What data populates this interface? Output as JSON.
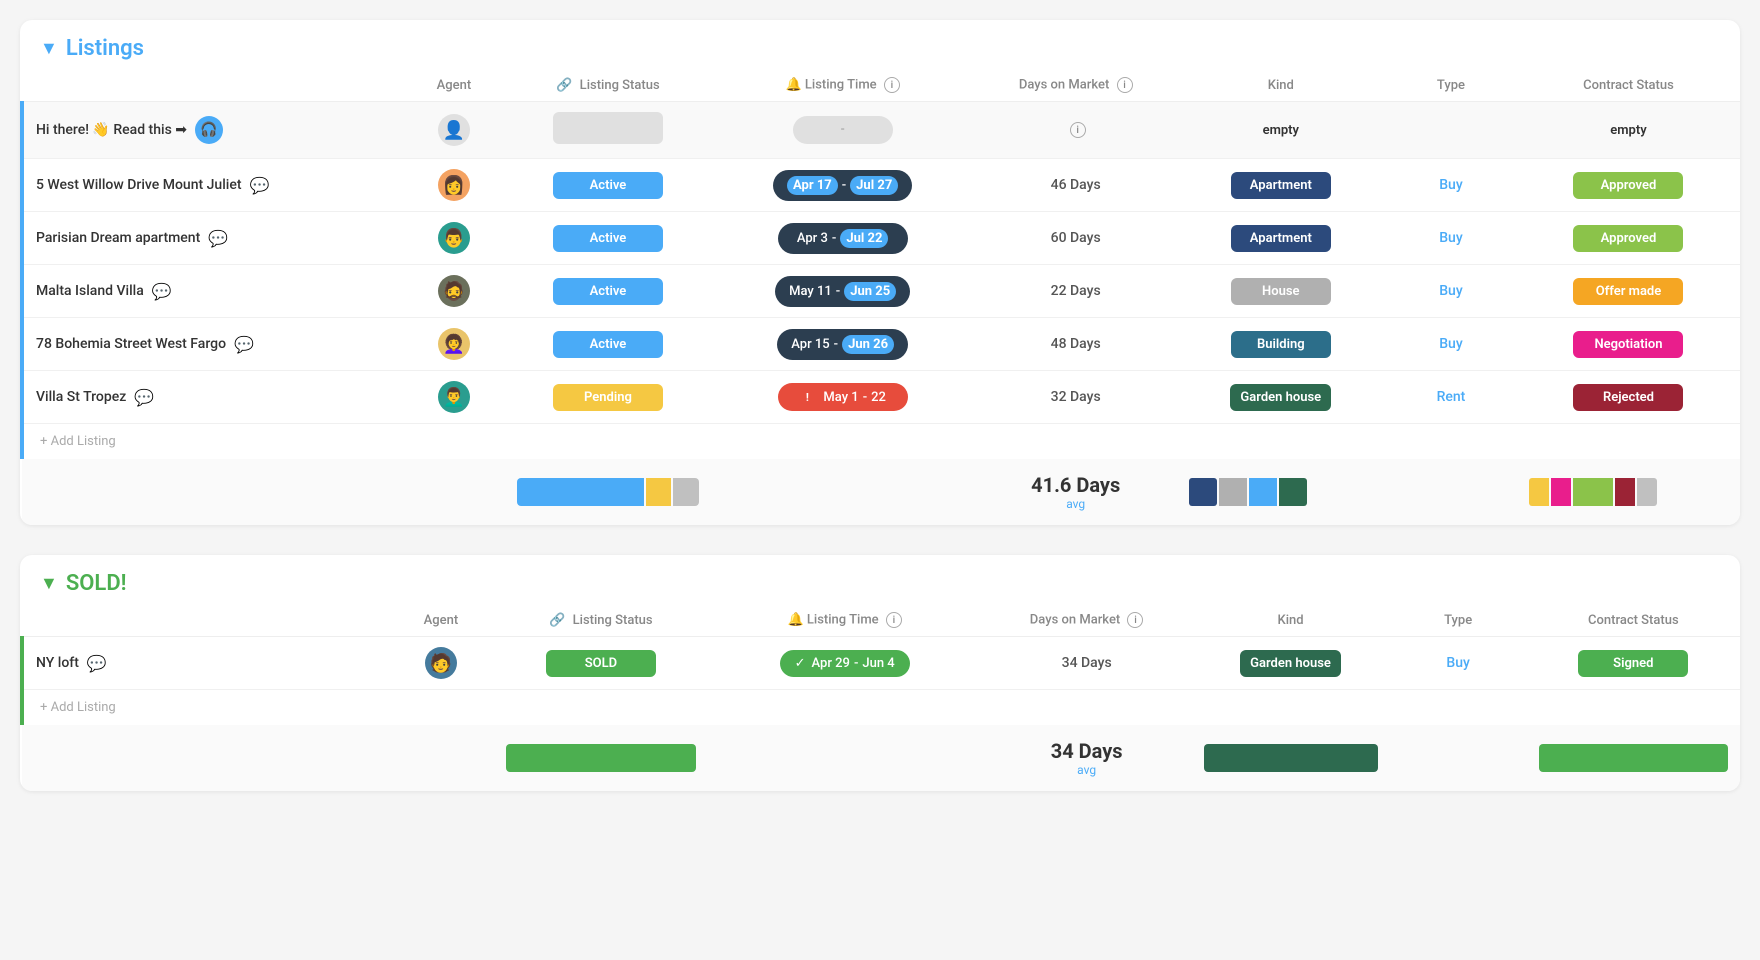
{
  "sections": [
    {
      "id": "listings",
      "title": "Listings",
      "color": "listings",
      "chevron": "▼",
      "columns": [
        "Agent",
        "Listing Status",
        "Listing Time",
        "Days on Market",
        "Kind",
        "Type",
        "Contract Status"
      ],
      "rows": [
        {
          "id": "hi-there",
          "name": "Hi there! 👋 Read this ➡",
          "hasChat": true,
          "agent": "placeholder",
          "listingStatus": "empty",
          "listingTime": "dash",
          "daysOnMarket": "info",
          "kind": "empty",
          "type": "",
          "contractStatus": "empty"
        },
        {
          "id": "west-willow",
          "name": "5 West Willow Drive Mount Juliet",
          "hasComment": true,
          "agent": "woman1",
          "listingStatus": "Active",
          "listingStatusClass": "status-active",
          "listingTime": "Apr 17 - Jul 27",
          "timeStart": "Apr 17",
          "timeEnd": "Jul 27",
          "timeClass": "time-dark",
          "highlightStart": true,
          "daysOnMarket": "46 Days",
          "kind": "Apartment",
          "kindClass": "kind-apartment",
          "type": "Buy",
          "contractStatus": "Approved",
          "contractClass": "contract-approved"
        },
        {
          "id": "parisian-dream",
          "name": "Parisian Dream apartment",
          "hasComment": true,
          "agent": "man1",
          "listingStatus": "Active",
          "listingStatusClass": "status-active",
          "listingTime": "Apr 3 - Jul 22",
          "timeStart": "Apr 3",
          "timeEnd": "Jul 22",
          "timeClass": "time-dark",
          "highlightEnd": true,
          "daysOnMarket": "60 Days",
          "kind": "Apartment",
          "kindClass": "kind-apartment",
          "type": "Buy",
          "contractStatus": "Approved",
          "contractClass": "contract-approved"
        },
        {
          "id": "malta-island",
          "name": "Malta Island Villa",
          "hasComment": true,
          "agent": "man2",
          "listingStatus": "Active",
          "listingStatusClass": "status-active",
          "listingTime": "May 11 - Jun 25",
          "timeStart": "May 11",
          "timeEnd": "Jun 25",
          "timeClass": "time-dark",
          "highlightEnd": true,
          "daysOnMarket": "22 Days",
          "kind": "House",
          "kindClass": "kind-house",
          "type": "Buy",
          "contractStatus": "Offer made",
          "contractClass": "contract-offer"
        },
        {
          "id": "bohemia-street",
          "name": "78 Bohemia Street West Fargo",
          "hasComment": true,
          "agent": "woman2",
          "listingStatus": "Active",
          "listingStatusClass": "status-active",
          "listingTime": "Apr 15 - Jun 26",
          "timeStart": "Apr 15",
          "timeEnd": "Jun 26",
          "timeClass": "time-dark",
          "highlightEnd": true,
          "daysOnMarket": "48 Days",
          "kind": "Building",
          "kindClass": "kind-building",
          "type": "Buy",
          "contractStatus": "Negotiation",
          "contractClass": "contract-negotiation"
        },
        {
          "id": "villa-st-tropez",
          "name": "Villa St Tropez",
          "hasComment": true,
          "agent": "man3",
          "listingStatus": "Pending",
          "listingStatusClass": "status-pending",
          "listingTime": "May 1 - 22",
          "timeStart": "May 1",
          "timeEnd": "22",
          "timeClass": "time-red",
          "hasAlert": true,
          "daysOnMarket": "32 Days",
          "kind": "Garden house",
          "kindClass": "kind-garden",
          "type": "Rent",
          "contractStatus": "Rejected",
          "contractClass": "contract-rejected"
        }
      ],
      "addListing": "+ Add Listing",
      "summary": {
        "avgDays": "41.6 Days",
        "avgLabel": "avg"
      }
    },
    {
      "id": "sold",
      "title": "SOLD!",
      "color": "sold",
      "chevron": "▼",
      "columns": [
        "Agent",
        "Listing Status",
        "Listing Time",
        "Days on Market",
        "Kind",
        "Type",
        "Contract Status"
      ],
      "rows": [
        {
          "id": "ny-loft",
          "name": "NY loft",
          "hasComment": true,
          "agent": "man4",
          "listingStatus": "SOLD",
          "listingStatusClass": "status-sold",
          "listingTime": "Apr 29 - Jun 4",
          "timeStart": "Apr 29",
          "timeEnd": "Jun 4",
          "timeClass": "time-green",
          "hasCheck": true,
          "daysOnMarket": "34 Days",
          "kind": "Garden house",
          "kindClass": "kind-garden",
          "type": "Buy",
          "contractStatus": "Signed",
          "contractClass": "contract-signed"
        }
      ],
      "addListing": "+ Add Listing",
      "summary": {
        "avgDays": "34 Days",
        "avgLabel": "avg"
      }
    }
  ],
  "icons": {
    "comment": "💬",
    "chat": "🎧",
    "info": "ℹ",
    "link": "🔗",
    "bell": "🔔",
    "alert": "!",
    "check": "✓",
    "chevron_down": "▼"
  },
  "avatars": {
    "woman1": "👩",
    "man1": "👨",
    "man2": "🧔",
    "woman2": "👩‍🦱",
    "man3": "👨‍🦱",
    "man4": "🧑"
  }
}
